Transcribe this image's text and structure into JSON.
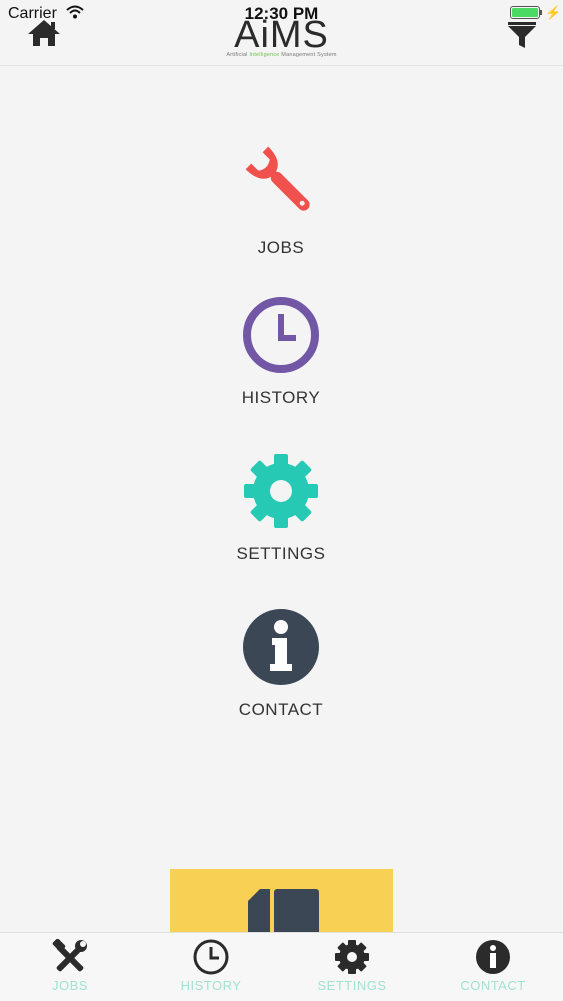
{
  "status_bar": {
    "carrier": "Carrier",
    "time": "12:30 PM",
    "battery_level": 1.0
  },
  "header": {
    "logo_text": "AiMS",
    "logo_sub_left": "Artificial",
    "logo_sub_green": "Intelligence",
    "logo_sub_right": "Management System"
  },
  "menu": {
    "items": [
      {
        "label": "JOBS",
        "icon": "wrench-icon",
        "color": "#f0514c"
      },
      {
        "label": "HISTORY",
        "icon": "clock-icon",
        "color": "#7157a5"
      },
      {
        "label": "SETTINGS",
        "icon": "gear-icon",
        "color": "#26c9b4"
      },
      {
        "label": "CONTACT",
        "icon": "info-icon",
        "color": "#3b4754"
      }
    ]
  },
  "tabs": [
    {
      "label": "JOBS",
      "icon": "tools-icon"
    },
    {
      "label": "HISTORY",
      "icon": "clock-icon"
    },
    {
      "label": "SETTINGS",
      "icon": "gear-icon"
    },
    {
      "label": "CONTACT",
      "icon": "info-icon"
    }
  ],
  "colors": {
    "tab_label": "#9fe3d0",
    "card": "#f8d054",
    "background": "#f4f4f5"
  }
}
